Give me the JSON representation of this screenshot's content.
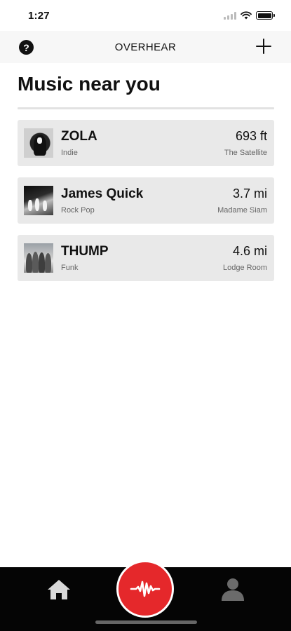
{
  "status_bar": {
    "time": "1:27"
  },
  "nav": {
    "title": "OVERHEAR",
    "help_glyph": "?",
    "icons": [
      "help-icon",
      "plus-icon"
    ]
  },
  "page": {
    "title": "Music near you"
  },
  "listings": [
    {
      "artist": "ZOLA",
      "genre": "Indie",
      "distance": "693 ft",
      "venue": "The Satellite"
    },
    {
      "artist": "James Quick",
      "genre": "Rock Pop",
      "distance": "3.7 mi",
      "venue": "Madame Siam"
    },
    {
      "artist": "THUMP",
      "genre": "Funk",
      "distance": "4.6 mi",
      "venue": "Lodge Room"
    }
  ],
  "tab_bar": {
    "icons": [
      "home-icon",
      "waveform-icon",
      "profile-icon"
    ]
  },
  "colors": {
    "accent": "#e5282b",
    "card": "#e9e9e9",
    "tab_bar": "#050505"
  }
}
